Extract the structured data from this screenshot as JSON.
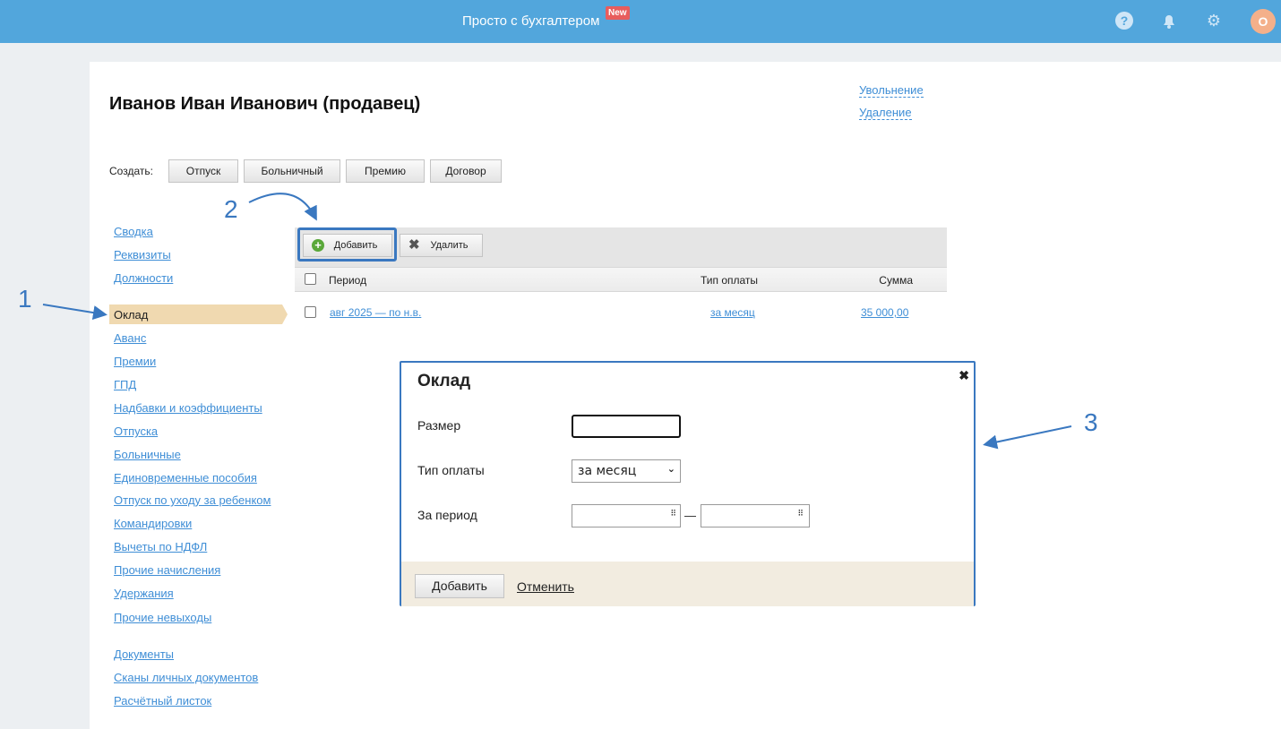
{
  "header": {
    "brand": "Просто с бухгалтером",
    "badge": "New",
    "avatar": "О"
  },
  "employee": {
    "title": "Иванов Иван Иванович (продавец)",
    "actions": [
      "Увольнение",
      "Удаление"
    ]
  },
  "create": {
    "label": "Создать:",
    "buttons": [
      "Отпуск",
      "Больничный",
      "Премию",
      "Договор"
    ]
  },
  "sidebar": {
    "group1": [
      "Сводка",
      "Реквизиты",
      "Должности"
    ],
    "active": "Оклад",
    "group2": [
      "Аванс",
      "Премии",
      "ГПД",
      "Надбавки и коэффициенты",
      "Отпуска",
      "Больничные",
      "Единовременные пособия",
      "Отпуск по уходу за ребенком",
      "Командировки",
      "Вычеты по НДФЛ",
      "Прочие начисления",
      "Удержания",
      "Прочие невыходы"
    ],
    "group3": [
      "Документы",
      "Сканы личных документов",
      "Расчётный листок"
    ]
  },
  "toolbar": {
    "add": "Добавить",
    "delete": "Удалить"
  },
  "table": {
    "columns": [
      "Период",
      "Тип оплаты",
      "Сумма"
    ],
    "rows": [
      {
        "period": "авг 2025 — по н.в.",
        "type": "за месяц",
        "sum": "35 000,00"
      }
    ]
  },
  "modal": {
    "title": "Оклад",
    "size_label": "Размер",
    "size_value": "",
    "type_label": "Тип оплаты",
    "type_value": "за месяц",
    "period_label": "За период",
    "period_sep": "—",
    "add": "Добавить",
    "cancel": "Отменить"
  },
  "annotations": [
    "1",
    "2",
    "3"
  ]
}
